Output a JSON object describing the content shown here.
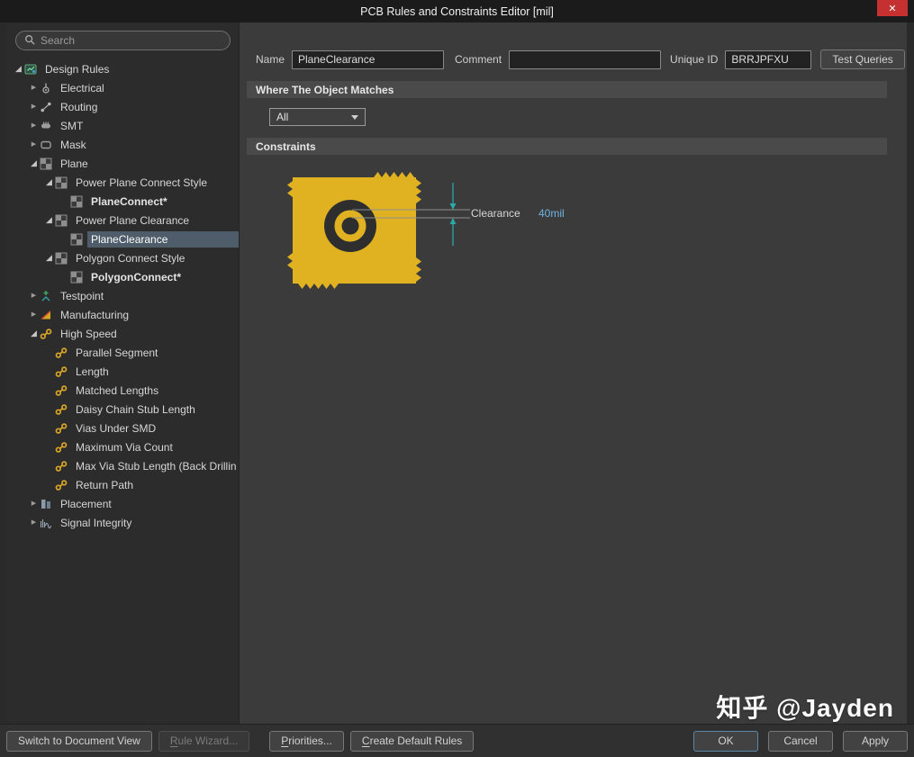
{
  "window": {
    "title": "PCB Rules and Constraints Editor [mil]"
  },
  "icons": {
    "close": "✕"
  },
  "sidebar": {
    "search": {
      "placeholder": "Search"
    },
    "tree": [
      {
        "label": "Design Rules",
        "level": 0,
        "state": "expanded",
        "icon": "design-rules"
      },
      {
        "label": "Electrical",
        "level": 1,
        "state": "collapsed",
        "icon": "electrical"
      },
      {
        "label": "Routing",
        "level": 1,
        "state": "collapsed",
        "icon": "routing"
      },
      {
        "label": "SMT",
        "level": 1,
        "state": "collapsed",
        "icon": "smt"
      },
      {
        "label": "Mask",
        "level": 1,
        "state": "collapsed",
        "icon": "mask"
      },
      {
        "label": "Plane",
        "level": 1,
        "state": "expanded",
        "icon": "plane"
      },
      {
        "label": "Power Plane Connect Style",
        "level": 2,
        "state": "expanded",
        "icon": "plane-rule"
      },
      {
        "label": "PlaneConnect*",
        "level": 3,
        "state": "none",
        "icon": "plane-rule",
        "bold": true
      },
      {
        "label": "Power Plane Clearance",
        "level": 2,
        "state": "expanded",
        "icon": "plane-rule"
      },
      {
        "label": "PlaneClearance",
        "level": 3,
        "state": "none",
        "icon": "plane-rule",
        "selected": true
      },
      {
        "label": "Polygon Connect Style",
        "level": 2,
        "state": "expanded",
        "icon": "plane-rule"
      },
      {
        "label": "PolygonConnect*",
        "level": 3,
        "state": "none",
        "icon": "plane-rule",
        "bold": true
      },
      {
        "label": "Testpoint",
        "level": 1,
        "state": "collapsed",
        "icon": "testpoint"
      },
      {
        "label": "Manufacturing",
        "level": 1,
        "state": "collapsed",
        "icon": "manufacturing"
      },
      {
        "label": "High Speed",
        "level": 1,
        "state": "expanded",
        "icon": "high-speed"
      },
      {
        "label": "Parallel Segment",
        "level": 2,
        "state": "none",
        "icon": "high-speed"
      },
      {
        "label": "Length",
        "level": 2,
        "state": "none",
        "icon": "high-speed"
      },
      {
        "label": "Matched Lengths",
        "level": 2,
        "state": "none",
        "icon": "high-speed"
      },
      {
        "label": "Daisy Chain Stub Length",
        "level": 2,
        "state": "none",
        "icon": "high-speed"
      },
      {
        "label": "Vias Under SMD",
        "level": 2,
        "state": "none",
        "icon": "high-speed"
      },
      {
        "label": "Maximum Via Count",
        "level": 2,
        "state": "none",
        "icon": "high-speed"
      },
      {
        "label": "Max Via Stub Length (Back Drillin",
        "level": 2,
        "state": "none",
        "icon": "high-speed"
      },
      {
        "label": "Return Path",
        "level": 2,
        "state": "none",
        "icon": "high-speed"
      },
      {
        "label": "Placement",
        "level": 1,
        "state": "collapsed",
        "icon": "placement"
      },
      {
        "label": "Signal Integrity",
        "level": 1,
        "state": "collapsed",
        "icon": "signal-integrity"
      }
    ]
  },
  "main": {
    "name_label": "Name",
    "name_value": "PlaneClearance",
    "comment_label": "Comment",
    "comment_value": "",
    "unique_id_label": "Unique ID",
    "unique_id_value": "BRRJPFXU",
    "test_queries_label": "Test Queries",
    "where_header": "Where The Object Matches",
    "scope_value": "All",
    "constraints_header": "Constraints",
    "constraint": {
      "label": "Clearance",
      "value": "40mil"
    }
  },
  "footer": {
    "left_buttons": [
      {
        "label": "Switch to Document View",
        "name": "switch-to-document-view-button",
        "enabled": true
      },
      {
        "label": "Rule Wizard...",
        "name": "rule-wizard-button",
        "enabled": false,
        "underline": 0
      },
      {
        "label": "Priorities...",
        "name": "priorities-button",
        "enabled": true,
        "underline": 0
      },
      {
        "label": "Create Default Rules",
        "name": "create-default-rules-button",
        "enabled": true,
        "underline": 0
      }
    ],
    "right_buttons": [
      {
        "label": "OK",
        "name": "ok-button",
        "enabled": true,
        "default": true
      },
      {
        "label": "Cancel",
        "name": "cancel-button",
        "enabled": true
      },
      {
        "label": "Apply",
        "name": "apply-button",
        "enabled": true
      }
    ]
  },
  "watermark": "知乎 @Jayden",
  "colors": {
    "accent_yellow": "#e0b120",
    "value_blue": "#6fb3e0",
    "selection": "#4e5d69",
    "close_red": "#c53131",
    "measure_teal": "#2ba8a8"
  }
}
